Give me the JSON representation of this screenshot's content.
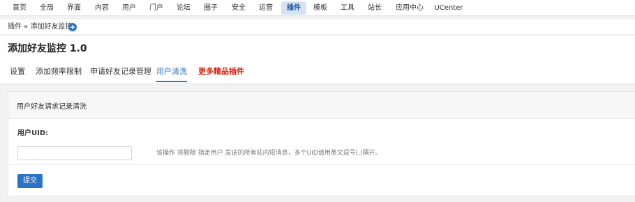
{
  "topnav": {
    "items": [
      {
        "label": "首页"
      },
      {
        "label": "全局"
      },
      {
        "label": "界面"
      },
      {
        "label": "内容"
      },
      {
        "label": "用户"
      },
      {
        "label": "门户"
      },
      {
        "label": "论坛"
      },
      {
        "label": "圈子"
      },
      {
        "label": "安全"
      },
      {
        "label": "运营"
      },
      {
        "label": "插件",
        "active": true
      },
      {
        "label": "模板"
      },
      {
        "label": "工具"
      },
      {
        "label": "站长"
      },
      {
        "label": "应用中心"
      },
      {
        "label": "UCenter"
      }
    ]
  },
  "breadcrumb": {
    "text": "插件 » 添加好友监控",
    "add_icon": "plus-circle-icon"
  },
  "header": {
    "title": "添加好友监控 1.0",
    "tabs": [
      {
        "label": "设置"
      },
      {
        "label": "添加频率限制"
      },
      {
        "label": "申请好友记录管理"
      },
      {
        "label": "用户清洗",
        "active": true
      },
      {
        "label": "更多精品插件",
        "promo": true
      }
    ]
  },
  "panel": {
    "title": "用户好友请求记录清洗",
    "uid_label": "用户UID:",
    "uid_value": "",
    "hint": "该操作 将删除 指定用户 发送的所有站内短消息，多个UID请用英文逗号(,)隔开。",
    "submit_label": "提交"
  },
  "colors": {
    "accent": "#2b73c4",
    "promo": "#d81e06",
    "active_nav_bg": "#d6e3f3"
  }
}
